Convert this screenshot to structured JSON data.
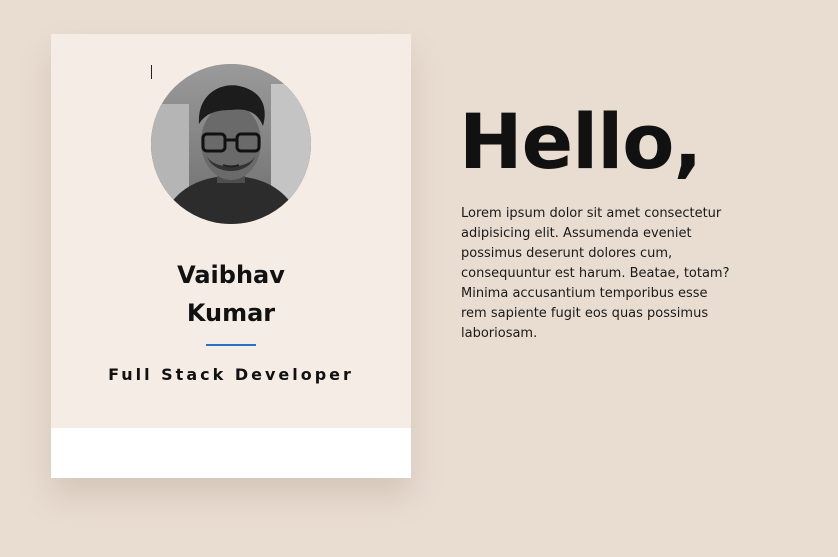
{
  "profile": {
    "first_name": "Vaibhav",
    "last_name": "Kumar",
    "role": "Full Stack Developer",
    "photo_icon": "profile-photo"
  },
  "intro": {
    "heading": "Hello,",
    "body": "Lorem ipsum dolor sit amet consectetur adipisicing elit. Assumenda eveniet possimus deserunt dolores cum, consequuntur est harum. Beatae, totam? Minima accusantium temporibus esse rem sapiente fugit eos quas possimus laboriosam."
  },
  "colors": {
    "background": "#e9ddd2",
    "card_top": "#f5ece6",
    "card_bottom": "#ffffff",
    "accent": "#2f6cc4",
    "text": "#111111"
  }
}
